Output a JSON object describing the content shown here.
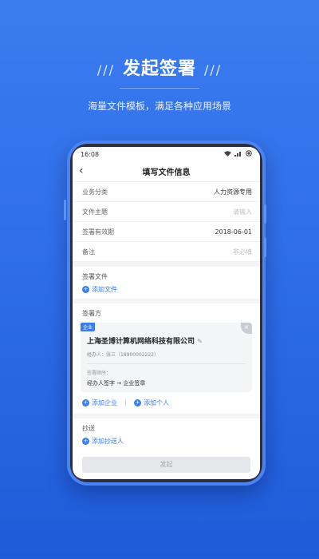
{
  "hero": {
    "title": "发起签署",
    "slashes_left": "///",
    "slashes_right": "///",
    "subtitle": "海量文件模板，满足各种应用场景"
  },
  "status_bar": {
    "time": "16:08",
    "icons": [
      "wifi-icon",
      "signal-icon",
      "battery-icon"
    ]
  },
  "nav": {
    "back": "‹",
    "title": "填写文件信息"
  },
  "form": [
    {
      "label": "业务分类",
      "value": "人力资源专用",
      "placeholder": false
    },
    {
      "label": "文件主题",
      "value": "请输入",
      "placeholder": true
    },
    {
      "label": "签署有效期",
      "value": "2018-06-01",
      "placeholder": false
    },
    {
      "label": "备注",
      "value": "非必填",
      "placeholder": true
    }
  ],
  "files": {
    "title": "签署文件",
    "add_label": "添加文件"
  },
  "signers": {
    "title": "签署方",
    "card": {
      "tag": "企业",
      "company": "上海圣博计算机网络科技有限公司",
      "handler": "经办人：张三（18900002222）",
      "order_label": "签署顺序：",
      "order_flow": "经办人签字 → 企业签章"
    },
    "add_company": "添加企业",
    "add_person": "添加个人"
  },
  "cc": {
    "title": "抄送",
    "add_label": "添加抄送人"
  },
  "submit": "发起",
  "colors": {
    "brand": "#3b7cf0",
    "background": "#2f6ee8"
  }
}
